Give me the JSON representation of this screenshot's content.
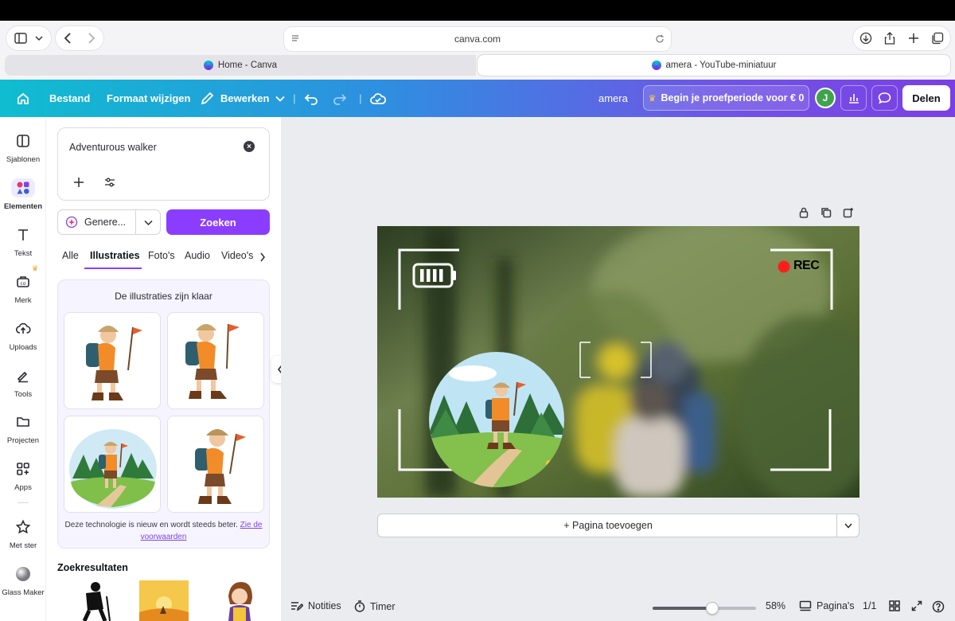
{
  "browser": {
    "url": "canva.com",
    "tabs": [
      {
        "label": "Home - Canva",
        "active": false
      },
      {
        "label": "amera - YouTube-miniatuur",
        "active": true
      }
    ]
  },
  "topbar": {
    "file": "Bestand",
    "resize": "Formaat wijzigen",
    "edit": "Bewerken",
    "doc_title": "amera",
    "trial": "Begin je proefperiode voor € 0",
    "avatar_initial": "J",
    "share": "Delen",
    "gradient_start": "#0fbdd0",
    "gradient_end": "#7b3fe4"
  },
  "rail": {
    "items": [
      {
        "label": "Sjablonen",
        "icon": "templates-icon"
      },
      {
        "label": "Elementen",
        "icon": "elements-icon",
        "active": true
      },
      {
        "label": "Tekst",
        "icon": "text-icon"
      },
      {
        "label": "Merk",
        "icon": "brand-icon"
      },
      {
        "label": "Uploads",
        "icon": "upload-icon"
      },
      {
        "label": "Tools",
        "icon": "tools-icon"
      },
      {
        "label": "Projecten",
        "icon": "folder-icon"
      },
      {
        "label": "Apps",
        "icon": "apps-icon"
      },
      {
        "label": "Met ster",
        "icon": "star-icon"
      },
      {
        "label": "Glass Maker",
        "icon": "glass-maker-icon"
      }
    ]
  },
  "panel": {
    "prompt": "Adventurous walker",
    "generator": "Genere...",
    "search": "Zoeken",
    "filters": [
      "Alle",
      "Illustraties",
      "Foto's",
      "Audio",
      "Video's"
    ],
    "active_filter": "Illustraties",
    "ready_text": "De illustraties zijn klaar",
    "disclaimer": "Deze technologie is nieuw en wordt steeds beter.",
    "disclaimer_link": "Zie de voorwaarden",
    "results_title": "Zoekresultaten",
    "accent": "#8b3dff"
  },
  "canvas": {
    "rec_label": "REC",
    "add_page": "+ Pagina toevoegen"
  },
  "footer": {
    "notes": "Notities",
    "timer": "Timer",
    "zoom": "58%",
    "zoom_fraction": 0.58,
    "pages": "Pagina's",
    "page_count": "1/1"
  }
}
